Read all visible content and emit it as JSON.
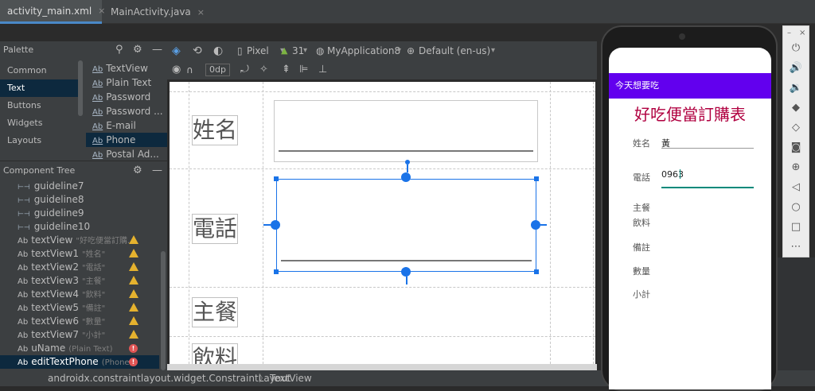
{
  "tabs": [
    {
      "label": "activity_main.xml",
      "close": "×",
      "icon_color": "#e8a838",
      "active": true
    },
    {
      "label": "MainActivity.java",
      "close": "×",
      "icon_color": "#4aa3c8",
      "active": false
    }
  ],
  "palette": {
    "title": "Palette",
    "categories": [
      "Common",
      "Text",
      "Buttons",
      "Widgets",
      "Layouts"
    ],
    "selected_category": "Text",
    "items": [
      {
        "prefix": "Ab",
        "label": "TextView"
      },
      {
        "prefix": "Ab",
        "label": "Plain Text"
      },
      {
        "prefix": "Ab",
        "label": "Password"
      },
      {
        "prefix": "Ab",
        "label": "Password ..."
      },
      {
        "prefix": "Ab",
        "label": "E-mail"
      },
      {
        "prefix": "Ab",
        "label": "Phone"
      },
      {
        "prefix": "Ab",
        "label": "Postal Ad..."
      }
    ],
    "selected_item": "Phone"
  },
  "component_tree": {
    "title": "Component Tree",
    "rows": [
      {
        "icon": "⊢⊣",
        "label": "guideline7",
        "sub": "",
        "status": ""
      },
      {
        "icon": "⊢⊣",
        "label": "guideline8",
        "sub": "",
        "status": ""
      },
      {
        "icon": "⊢⊣",
        "label": "guideline9",
        "sub": "",
        "status": ""
      },
      {
        "icon": "⊢⊣",
        "label": "guideline10",
        "sub": "",
        "status": ""
      },
      {
        "icon": "Ab",
        "label": "textView",
        "sub": "\"好吃便當訂購...",
        "status": "warning"
      },
      {
        "icon": "Ab",
        "label": "textView1",
        "sub": "\"姓名\"",
        "status": "warning"
      },
      {
        "icon": "Ab",
        "label": "textView2",
        "sub": "\"電話\"",
        "status": "warning"
      },
      {
        "icon": "Ab",
        "label": "textView3",
        "sub": "\"主餐\"",
        "status": "warning"
      },
      {
        "icon": "Ab",
        "label": "textView4",
        "sub": "\"飲料\"",
        "status": "warning"
      },
      {
        "icon": "Ab",
        "label": "textView5",
        "sub": "\"備註\"",
        "status": "warning"
      },
      {
        "icon": "Ab",
        "label": "textView6",
        "sub": "\"數量\"",
        "status": "warning"
      },
      {
        "icon": "Ab",
        "label": "textView7",
        "sub": "\"小計\"",
        "status": "warning"
      },
      {
        "icon": "Ab",
        "label": "uName",
        "sub": "(Plain Text)",
        "status": "error"
      },
      {
        "icon": "Ab",
        "label": "editTextPhone",
        "sub": "(Phone)",
        "status": "error"
      }
    ],
    "selected": "editTextPhone"
  },
  "toolbar": {
    "device": "Pixel",
    "api": "31",
    "app": "MyApplication8",
    "locale": "Default (en-us)",
    "margin": "0dp"
  },
  "design": {
    "labels": [
      "姓名",
      "電話",
      "主餐",
      "飲料"
    ]
  },
  "status_bar": {
    "path": "androidx.constraintlayout.widget.ConstraintLayout",
    "separator": "〉",
    "leaf": "TextView"
  },
  "phone_preview": {
    "appbar_title": "今天想要吃",
    "heading": "好吃便當訂購表",
    "fields": [
      {
        "label": "姓名",
        "value": "黃"
      },
      {
        "label": "電話",
        "value": "0963"
      }
    ],
    "labels": [
      "主餐",
      "飲料",
      "備註",
      "數量",
      "小計"
    ]
  },
  "emulator_controls": {
    "window_minimize": "–",
    "window_close": "×",
    "icons": [
      "power-icon",
      "volume-up-icon",
      "volume-down-icon",
      "rotate-left-icon",
      "rotate-right-icon",
      "camera-icon",
      "zoom-icon",
      "back-icon",
      "home-icon",
      "overview-icon",
      "more-icon"
    ]
  },
  "colors": {
    "appbar": "#6200ee",
    "heading": "#b00040",
    "selection": "#1a73e8",
    "accent_line": "#00897b"
  }
}
